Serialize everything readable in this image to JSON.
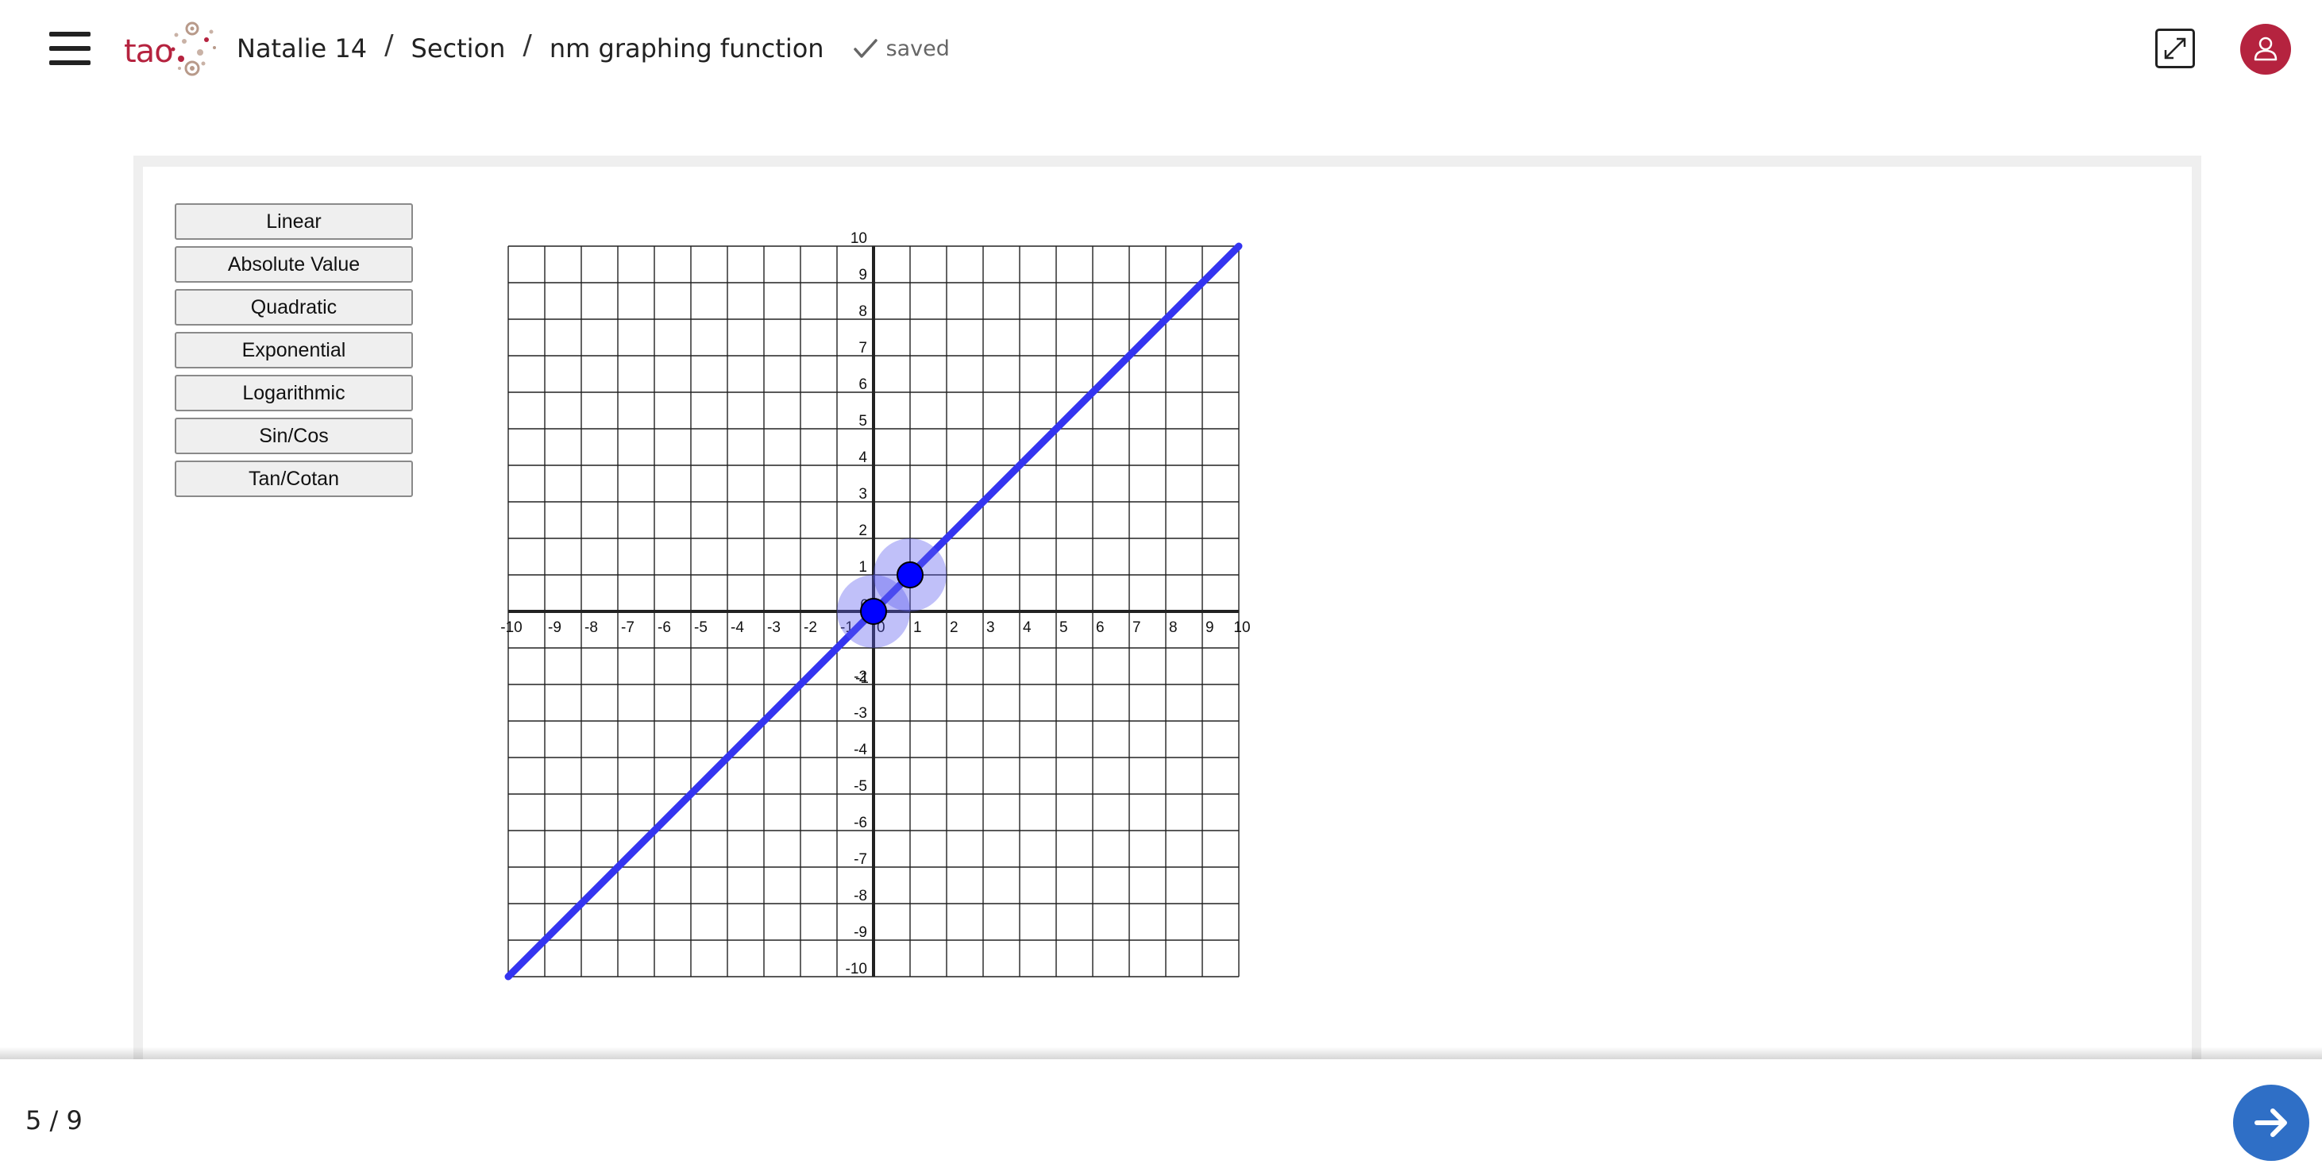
{
  "header": {
    "logo_text": "tao",
    "breadcrumb": {
      "test": "Natalie 14",
      "separator": "/",
      "section": "Section",
      "item": "nm graphing function"
    },
    "status": "saved"
  },
  "icons": {
    "menu": "hamburger-menu-icon",
    "logo": "tao-logo",
    "saved": "checkmark-icon",
    "fullscreen": "expand-icon",
    "user": "user-icon",
    "next": "arrow-right-icon"
  },
  "function_buttons": [
    "Linear",
    "Absolute Value",
    "Quadratic",
    "Exponential",
    "Logarithmic",
    "Sin/Cos",
    "Tan/Cotan"
  ],
  "chart_data": {
    "type": "line",
    "xlim": [
      -10,
      10
    ],
    "ylim": [
      -10,
      10
    ],
    "x_ticks": [
      -10,
      -9,
      -8,
      -7,
      -6,
      -5,
      -4,
      -3,
      -2,
      -1,
      0,
      1,
      2,
      3,
      4,
      5,
      6,
      7,
      8,
      9,
      10
    ],
    "y_ticks": [
      -10,
      -9,
      -8,
      -7,
      -6,
      -5,
      -4,
      -3,
      -2,
      -1,
      0,
      1,
      2,
      3,
      4,
      5,
      6,
      7,
      8,
      9,
      10
    ],
    "grid": true,
    "series": [
      {
        "x": [
          -10,
          10
        ],
        "y": [
          -10,
          10
        ],
        "color": "#3434f0"
      }
    ],
    "control_points": [
      {
        "x": 0,
        "y": 0
      },
      {
        "x": 1,
        "y": 1
      }
    ]
  },
  "footer": {
    "progress": "5 / 9"
  },
  "colors": {
    "brand": "#b5233f",
    "line": "#3434f0",
    "point": "#0000ff",
    "next_button": "#2f6fc6"
  }
}
